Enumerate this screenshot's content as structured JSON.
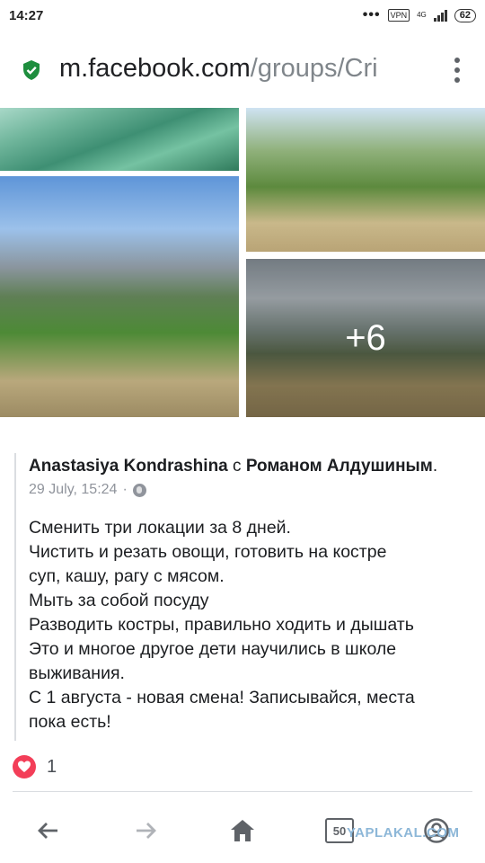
{
  "status_bar": {
    "time": "14:27",
    "vpn": "VPN",
    "network": "4G",
    "battery": "62"
  },
  "browser": {
    "url_domain": "m.facebook.com",
    "url_path": "/groups/Cri"
  },
  "photos": {
    "more_count": "+6"
  },
  "post": {
    "author": "Anastasiya Kondrashina",
    "with_word": "с",
    "tagged": "Романом Алдушиным",
    "period": ".",
    "timestamp": "29 July, 15:24",
    "separator": "·",
    "body_lines": [
      "Сменить три локации за 8 дней.",
      "Чистить и резать овощи, готовить на костре",
      "суп, кашу, рагу с мясом.",
      "Мыть за собой посуду",
      "Разводить костры, правильно ходить и дышать",
      "Это и многое другое дети научились в школе",
      "выживания.",
      "С 1 августа - новая смена! Записывайся, места",
      "пока есть!"
    ],
    "reaction_count": "1"
  },
  "bottom_nav": {
    "tabs_count": "50",
    "watermark": "YAPLAKAL.COM"
  },
  "colors": {
    "secure": "#1e8e3e",
    "love": "#f33e58",
    "icon": "#5f6368"
  }
}
